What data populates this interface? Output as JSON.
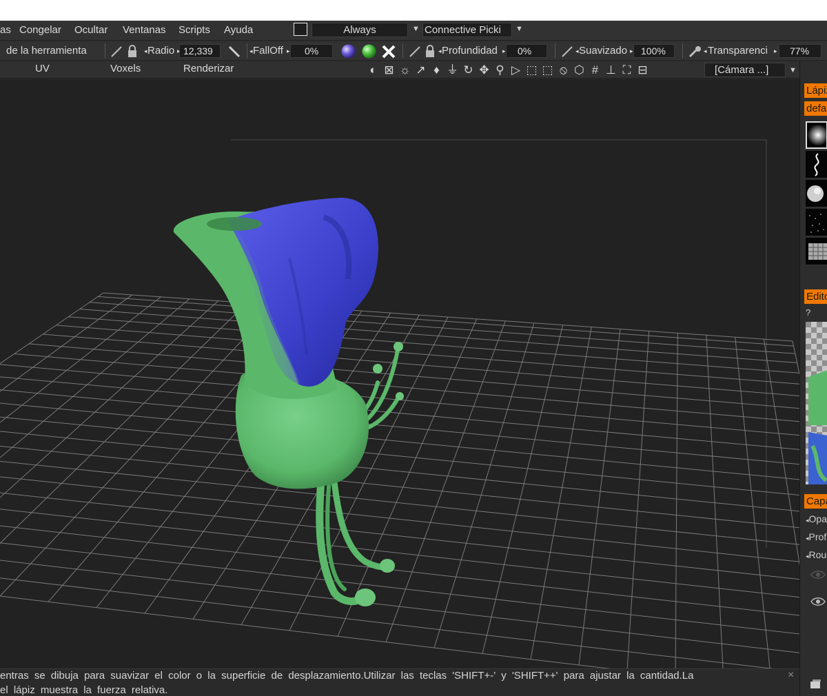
{
  "menubar": {
    "items": [
      "as",
      "Congelar",
      "Ocultar",
      "Ventanas",
      "Scripts",
      "Ayuda"
    ],
    "mode_select": "Always",
    "picking_select": "Connective  Picki"
  },
  "toolbar": {
    "tool_label": "de la herramienta",
    "radius_label": "Radio",
    "radius_value": "12,339",
    "falloff_label": "FallOff",
    "falloff_value": "0%",
    "depth_label": "Profundidad",
    "depth_value": "0%",
    "smooth_label": "Suavizado",
    "smooth_value": "100%",
    "transparency_label": "Transparenci",
    "transparency_value": "77%"
  },
  "tabs": [
    "UV",
    "Voxels",
    "Renderizar"
  ],
  "camera_select": "[Cámara  ...]",
  "right_panel": {
    "brush_header": "Lápiz",
    "brush_preset": "default",
    "editor_header": "Editor",
    "editor_hint": "?",
    "layers_header": "Capas",
    "layer_rows": [
      "Opacidad",
      "Profundidad",
      "Rough"
    ]
  },
  "status": {
    "line1": "entras se dibuja para suavizar el color o la superficie de desplazamiento.Utilizar las teclas 'SHIFT+-' y 'SHIFT++' para ajustar la cantidad.La",
    "line2": "el lápiz muestra la fuerza relativa.",
    "close": "×"
  },
  "colors": {
    "accent": "#f07800",
    "model_green": "#5bb86a",
    "model_blue": "#3a3ec8",
    "viewport_bg": "#222222"
  }
}
